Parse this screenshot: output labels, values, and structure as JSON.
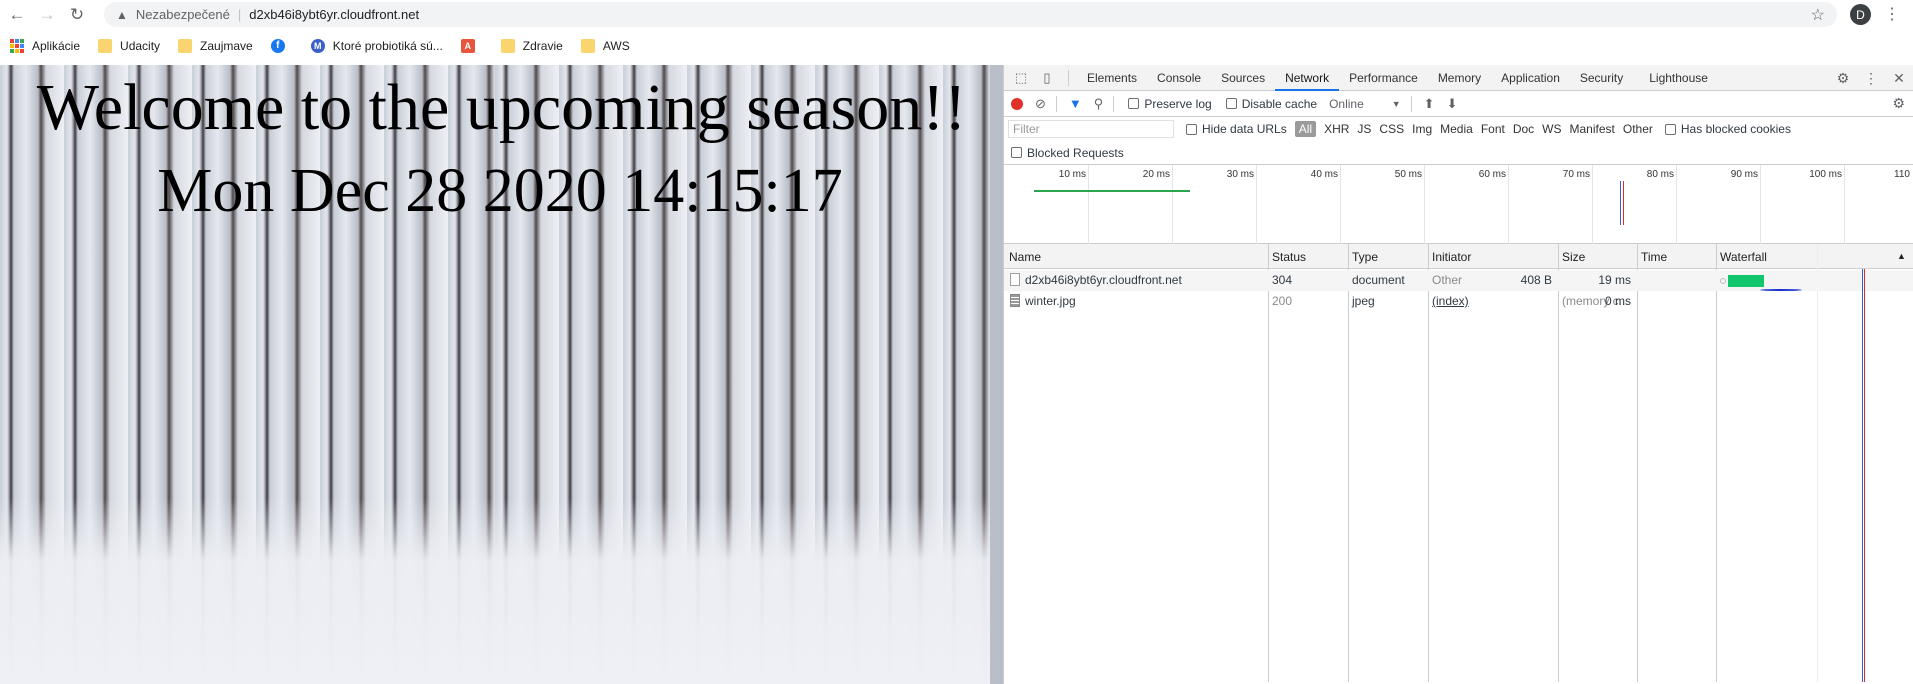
{
  "browser": {
    "security_label": "Nezabezpečené",
    "url": "d2xb46i8ybt6yr.cloudfront.net",
    "avatar_letter": "D",
    "bookmarks": [
      {
        "label": "Aplikácie",
        "icon": "apps-grid-icon"
      },
      {
        "label": "Udacity",
        "icon": "folder-icon"
      },
      {
        "label": "Zaujmave",
        "icon": "folder-icon"
      },
      {
        "label": "",
        "icon": "facebook-icon"
      },
      {
        "label": "Ktoré probiotiká sú...",
        "icon": "site-m-icon"
      },
      {
        "label": "",
        "icon": "site-a-icon"
      },
      {
        "label": "Zdravie",
        "icon": "folder-icon"
      },
      {
        "label": "AWS",
        "icon": "folder-icon"
      }
    ]
  },
  "page": {
    "heading": "Welcome to the upcoming season!!",
    "date": "Mon Dec 28 2020 14:15:17"
  },
  "devtools": {
    "tabs": [
      "Elements",
      "Console",
      "Sources",
      "Network",
      "Performance",
      "Memory",
      "Application",
      "Security",
      "Lighthouse"
    ],
    "active_tab": "Network",
    "controls": {
      "preserve_log": "Preserve log",
      "disable_cache": "Disable cache",
      "throttle": "Online"
    },
    "filter": {
      "placeholder": "Filter",
      "hide_data_urls": "Hide data URLs",
      "types": [
        "All",
        "XHR",
        "JS",
        "CSS",
        "Img",
        "Media",
        "Font",
        "Doc",
        "WS",
        "Manifest",
        "Other"
      ],
      "has_blocked_cookies": "Has blocked cookies",
      "blocked_requests": "Blocked Requests"
    },
    "overview_ticks": [
      "10 ms",
      "20 ms",
      "30 ms",
      "40 ms",
      "50 ms",
      "60 ms",
      "70 ms",
      "80 ms",
      "90 ms",
      "100 ms",
      "110"
    ],
    "columns": [
      "Name",
      "Status",
      "Type",
      "Initiator",
      "Size",
      "Time",
      "Waterfall"
    ],
    "rows": [
      {
        "name": "d2xb46i8ybt6yr.cloudfront.net",
        "status": "304",
        "type": "document",
        "initiator": "Other",
        "size": "408 B",
        "time": "19 ms"
      },
      {
        "name": "winter.jpg",
        "status": "200",
        "type": "jpeg",
        "initiator": "(index)",
        "size": "(memory c...",
        "time": "0 ms"
      }
    ]
  },
  "colors": {
    "accent": "#1a73e8",
    "record": "#e0322a",
    "waterfall_bar": "#10c56b",
    "annotation": "#1a2fcf"
  }
}
